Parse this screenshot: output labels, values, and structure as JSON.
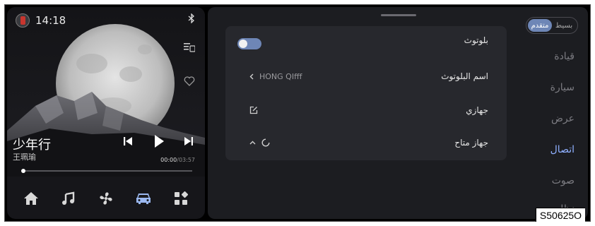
{
  "status": {
    "time": "14:18",
    "bluetooth_icon": "bluetooth-icon"
  },
  "media": {
    "title": "少年行",
    "artist": "王珮瑜",
    "elapsed": "00:00",
    "separator": "/",
    "duration": "03:57",
    "progress_fraction": 0.0
  },
  "dock": {
    "items": [
      "home-icon",
      "music-icon",
      "fan-icon",
      "car-icon",
      "apps-icon"
    ],
    "active": "car-icon"
  },
  "mode": {
    "simple": "بسيط",
    "advanced": "متقدم",
    "active": "advanced"
  },
  "nav": {
    "items": [
      "قيادة",
      "سيارة",
      "عرض",
      "اتصال",
      "صوت",
      "نظام"
    ],
    "active": "اتصال"
  },
  "settings": {
    "rows": [
      {
        "label": "بلوتوث",
        "toggle": "off"
      },
      {
        "label": "اسم البلوتوث",
        "value": "HONG QIfff"
      },
      {
        "label": "جهازي"
      },
      {
        "label": "جهاز متاح"
      }
    ]
  },
  "watermark": "S50625O",
  "colors": {
    "accent": "#6e86b6",
    "nav_active": "#8fb0ff"
  }
}
